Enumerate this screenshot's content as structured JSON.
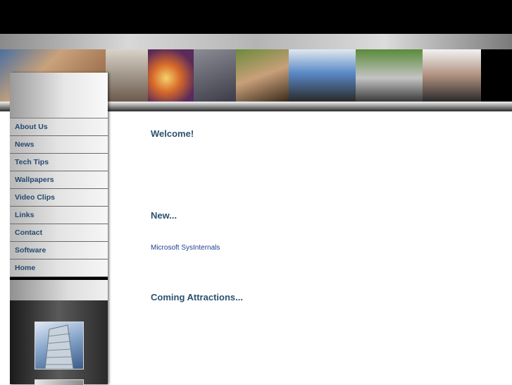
{
  "nav": {
    "items": [
      {
        "label": "About Us"
      },
      {
        "label": "News"
      },
      {
        "label": "Tech Tips"
      },
      {
        "label": "Wallpapers"
      },
      {
        "label": "Video Clips"
      },
      {
        "label": "Links"
      },
      {
        "label": "Contact"
      },
      {
        "label": "Software"
      },
      {
        "label": "Home"
      }
    ]
  },
  "main": {
    "welcome_heading": "Welcome!",
    "new_heading": "New...",
    "new_link": "Microsoft SysInternals",
    "coming_heading": "Coming Attractions..."
  },
  "colors": {
    "heading": "#2c5170",
    "nav_text": "#27496e",
    "link": "#1f3f8f"
  }
}
